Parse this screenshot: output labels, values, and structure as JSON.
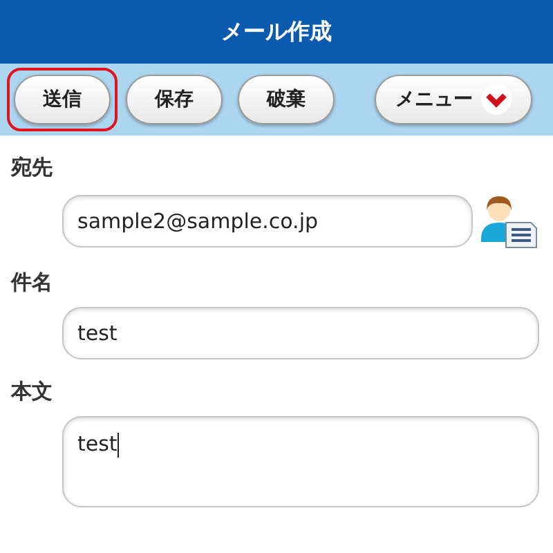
{
  "header": {
    "title": "メール作成"
  },
  "toolbar": {
    "buttons": [
      {
        "label": "送信",
        "kind": "plain",
        "selected": true
      },
      {
        "label": "保存",
        "kind": "plain",
        "selected": false
      },
      {
        "label": "破棄",
        "kind": "plain",
        "selected": false
      },
      {
        "label": "メニュー",
        "kind": "menu",
        "selected": false
      }
    ]
  },
  "fields": [
    {
      "label": "宛先",
      "value": "sample2@sample.co.jp",
      "kind": "address",
      "focused": false
    },
    {
      "label": "件名",
      "value": "test",
      "kind": "line",
      "focused": false
    },
    {
      "label": "本文",
      "value": "test",
      "kind": "multiline",
      "focused": true
    }
  ]
}
